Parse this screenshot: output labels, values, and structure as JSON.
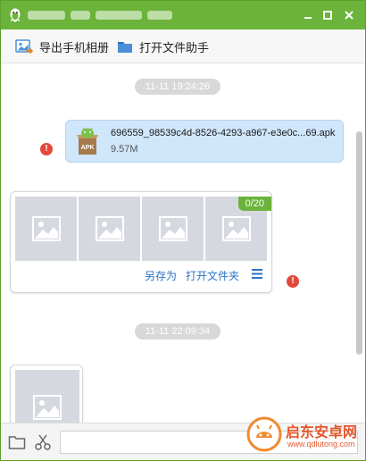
{
  "titlebar": {
    "icons": {
      "app": "qq-penguin-icon",
      "minimize": "minimize-icon",
      "maximize": "maximize-icon",
      "close": "close-icon"
    }
  },
  "toolbar": {
    "export_album_label": "导出手机相册",
    "open_file_helper_label": "打开文件助手"
  },
  "chat": {
    "messages": [
      {
        "timestamp": "11-11 19:24:26"
      },
      {
        "file_name": "696559_98539c4d-8526-4293-a967-e3e0c...69.apk",
        "file_size": "9.57M",
        "status_icon": "error-icon"
      },
      {
        "album_counter": "0/20",
        "save_as_label": "另存为",
        "open_folder_label": "打开文件夹",
        "status_icon": "error-icon"
      },
      {
        "timestamp": "11-11 22:09:34"
      }
    ]
  },
  "watermark": {
    "name": "启东安卓网",
    "url": "www.qdlutong.com"
  },
  "colors": {
    "title_green": "#6bb33a",
    "bubble_blue": "#cfe6fb",
    "link_blue": "#2b73c7",
    "error_red": "#e2493a"
  }
}
